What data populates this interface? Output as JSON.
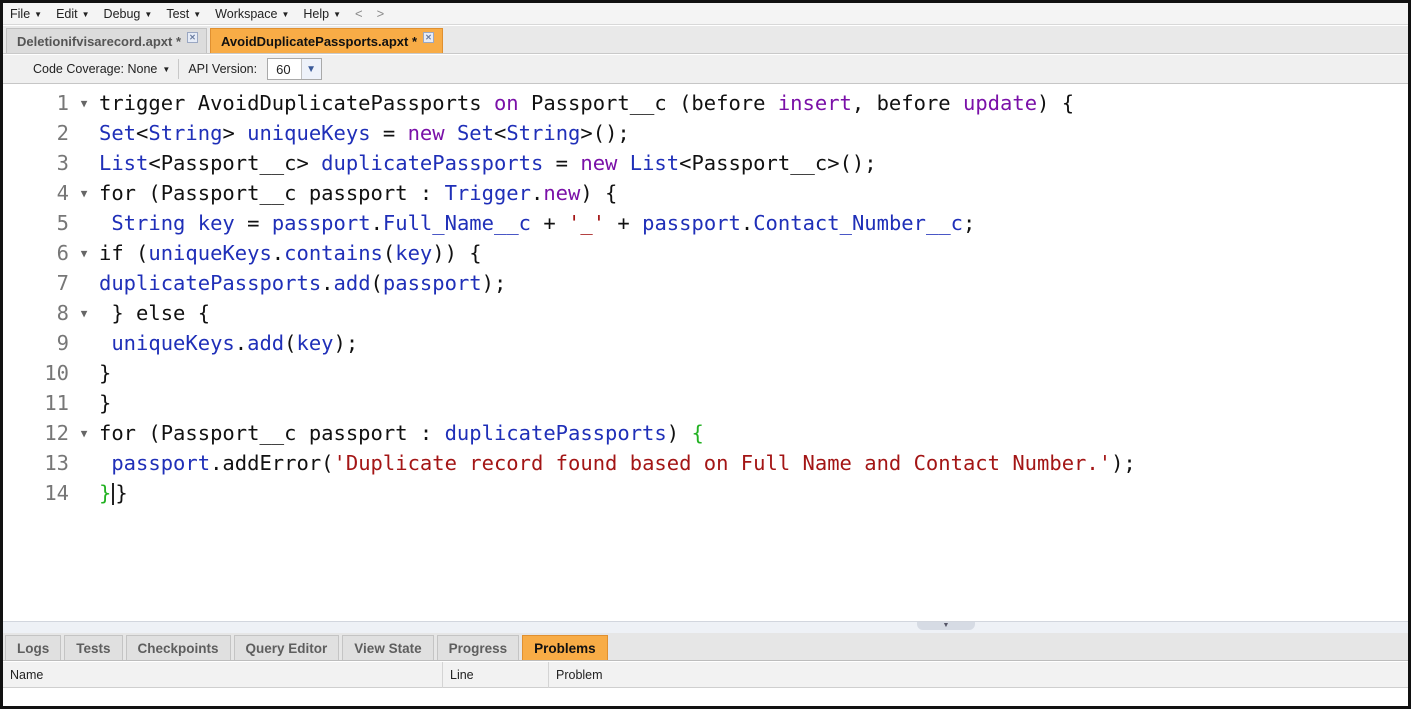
{
  "menu": {
    "items": [
      {
        "label": "File"
      },
      {
        "label": "Edit"
      },
      {
        "label": "Debug"
      },
      {
        "label": "Test"
      },
      {
        "label": "Workspace"
      },
      {
        "label": "Help"
      }
    ],
    "back": "<",
    "forward": ">"
  },
  "file_tabs": [
    {
      "label": "Deletionifvisarecord.apxt *",
      "active": false
    },
    {
      "label": "AvoidDuplicatePassports.apxt *",
      "active": true
    }
  ],
  "toolbar": {
    "coverage_label": "Code Coverage: None",
    "api_label": "API Version:",
    "api_value": "60"
  },
  "editor": {
    "lines": [
      {
        "num": "1",
        "foldable": true,
        "code": "trigger AvoidDuplicatePassports on Passport__c (before insert, before update) {"
      },
      {
        "num": "2",
        "foldable": false,
        "code": "Set<String> uniqueKeys = new Set<String>();"
      },
      {
        "num": "3",
        "foldable": false,
        "code": "List<Passport__c> duplicatePassports = new List<Passport__c>();"
      },
      {
        "num": "4",
        "foldable": true,
        "code": "for (Passport__c passport : Trigger.new) {"
      },
      {
        "num": "5",
        "foldable": false,
        "code": " String key = passport.Full_Name__c + '_' + passport.Contact_Number__c;"
      },
      {
        "num": "6",
        "foldable": true,
        "code": "if (uniqueKeys.contains(key)) {"
      },
      {
        "num": "7",
        "foldable": false,
        "code": "duplicatePassports.add(passport);"
      },
      {
        "num": "8",
        "foldable": true,
        "code": " } else {"
      },
      {
        "num": "9",
        "foldable": false,
        "code": " uniqueKeys.add(key);"
      },
      {
        "num": "10",
        "foldable": false,
        "code": "}"
      },
      {
        "num": "11",
        "foldable": false,
        "code": "}"
      },
      {
        "num": "12",
        "foldable": true,
        "code": "for (Passport__c passport : duplicatePassports) {"
      },
      {
        "num": "13",
        "foldable": false,
        "code": " passport.addError('Duplicate record found based on Full Name and Contact Number.');"
      },
      {
        "num": "14",
        "foldable": false,
        "code": "}}"
      }
    ]
  },
  "bottom_tabs": [
    {
      "label": "Logs",
      "active": false
    },
    {
      "label": "Tests",
      "active": false
    },
    {
      "label": "Checkpoints",
      "active": false
    },
    {
      "label": "Query Editor",
      "active": false
    },
    {
      "label": "View State",
      "active": false
    },
    {
      "label": "Progress",
      "active": false
    },
    {
      "label": "Problems",
      "active": true
    }
  ],
  "problems_table": {
    "columns": [
      "Name",
      "Line",
      "Problem"
    ]
  },
  "colors": {
    "active_tab": "#f8ac46",
    "keyword": "#7a10a8",
    "type": "#1f2fb8",
    "string": "#a31515",
    "matched_brace": "#22b122"
  }
}
